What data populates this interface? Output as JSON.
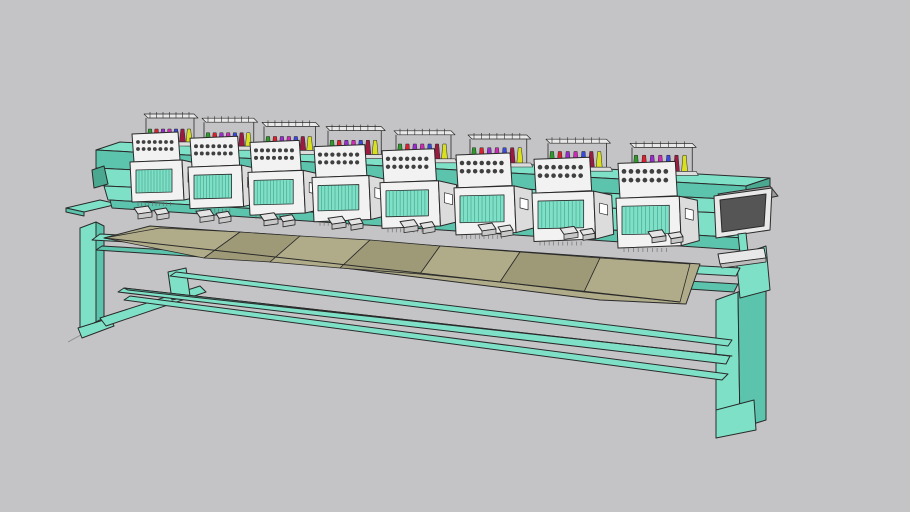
{
  "scene": {
    "subject": "multi-head-embroidery-machine-3d-model",
    "head_count": 8,
    "thread_colors_per_head": [
      "#2e9a2a",
      "#e01e2c",
      "#9b2bd0",
      "#d028b8",
      "#3848e0",
      "#9a1a40",
      "#d8e020"
    ],
    "colors": {
      "background": "#c4c4c6",
      "frame": "#7fe0c8",
      "frame_shadow": "#5cc4ac",
      "frame_dark": "#4aa890",
      "outline": "#2a2a2a",
      "table": "#9e9a78",
      "table_light": "#b0ac8a",
      "head_body": "#f2f2f2",
      "head_shade": "#dcdcdc",
      "panel_button": "#404040",
      "screen": "#555555"
    }
  }
}
